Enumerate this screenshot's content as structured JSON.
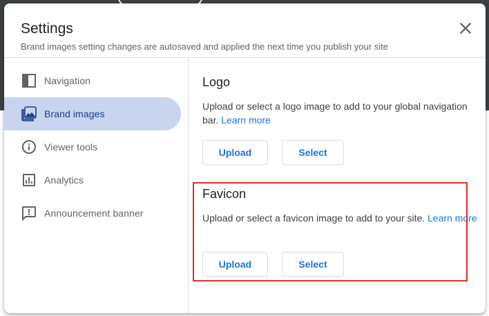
{
  "dialog": {
    "title": "Settings",
    "subtitle": "Brand images setting changes are autosaved and applied the next time you publish your site",
    "close_icon": "close-icon"
  },
  "sidebar": {
    "items": [
      {
        "label": "Navigation",
        "icon": "navigation-panel-icon",
        "active": false
      },
      {
        "label": "Brand images",
        "icon": "photo-library-icon",
        "active": true
      },
      {
        "label": "Viewer tools",
        "icon": "info-icon",
        "active": false
      },
      {
        "label": "Analytics",
        "icon": "analytics-icon",
        "active": false
      },
      {
        "label": "Announcement banner",
        "icon": "announcement-icon",
        "active": false
      }
    ]
  },
  "logo": {
    "title": "Logo",
    "description": "Upload or select a logo image to add to your global navigation bar.",
    "link": "Learn more",
    "upload_label": "Upload",
    "select_label": "Select"
  },
  "favicon": {
    "title": "Favicon",
    "description": "Upload or select a favicon image to add to your site.",
    "link": "Learn more",
    "upload_label": "Upload",
    "select_label": "Select",
    "highlighted": true
  },
  "colors": {
    "accent": "#1a73e8",
    "active_nav_bg": "#c9d4ee",
    "highlight_border": "#d93025"
  }
}
